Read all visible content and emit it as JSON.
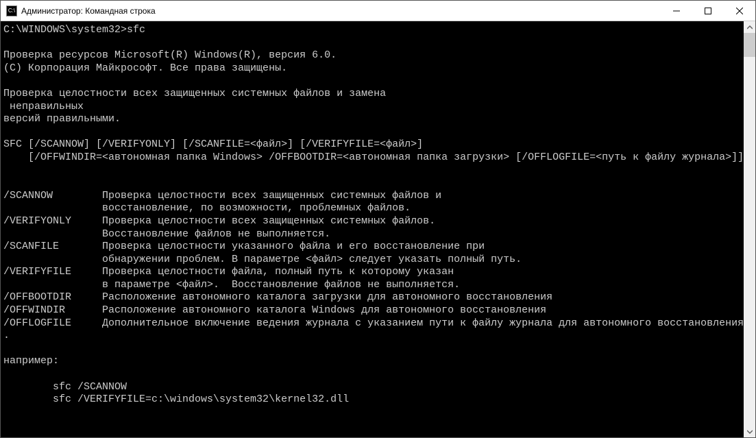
{
  "window": {
    "title": "Администратор: Командная строка",
    "icon_label": "C:\\"
  },
  "console": {
    "prompt": "C:\\WINDOWS\\system32>",
    "command": "sfc",
    "lines": [
      "C:\\WINDOWS\\system32>sfc",
      "",
      "Проверка ресурсов Microsoft(R) Windows(R), версия 6.0.",
      "(C) Корпорация Майкрософт. Все права защищены.",
      "",
      "Проверка целостности всех защищенных системных файлов и замена",
      " неправильных",
      "версий правильными.",
      "",
      "SFC [/SCANNOW] [/VERIFYONLY] [/SCANFILE=<файл>] [/VERIFYFILE=<файл>]",
      "    [/OFFWINDIR=<автономная папка Windows> /OFFBOOTDIR=<автономная папка загрузки> [/OFFLOGFILE=<путь к файлу журнала>]]",
      "",
      "",
      "/SCANNOW        Проверка целостности всех защищенных системных файлов и",
      "                восстановление, по возможности, проблемных файлов.",
      "/VERIFYONLY     Проверка целостности всех защищенных системных файлов.",
      "                Восстановление файлов не выполняется.",
      "/SCANFILE       Проверка целостности указанного файла и его восстановление при",
      "                обнаружении проблем. В параметре <файл> следует указать полный путь.",
      "/VERIFYFILE     Проверка целостности файла, полный путь к которому указан",
      "                в параметре <файл>.  Восстановление файлов не выполняется.",
      "/OFFBOOTDIR     Расположение автономного каталога загрузки для автономного восстановления",
      "/OFFWINDIR      Расположение автономного каталога Windows для автономного восстановления",
      "/OFFLOGFILE     Дополнительное включение ведения журнала с указанием пути к файлу журнала для автономного восстановления",
      ".",
      "",
      "например:",
      "",
      "        sfc /SCANNOW",
      "        sfc /VERIFYFILE=c:\\windows\\system32\\kernel32.dll"
    ]
  }
}
